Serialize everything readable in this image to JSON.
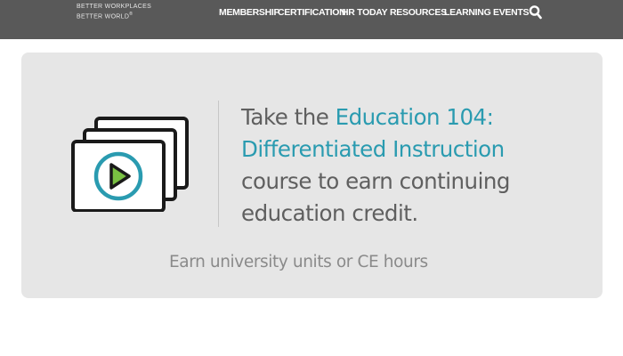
{
  "header": {
    "tagline_line1": "BETTER WORKPLACES",
    "tagline_line2": "BETTER WORLD",
    "trademark": "®",
    "nav": [
      {
        "label": "MEMBERSHIP"
      },
      {
        "label": "CERTIFICATION"
      },
      {
        "label": "HR TODAY"
      },
      {
        "label": "RESOURCES"
      },
      {
        "label": "LEARNING"
      },
      {
        "label": "EVENTS"
      }
    ],
    "search_icon": "search-icon"
  },
  "promo": {
    "icon": "video-course-icon",
    "text_before": "Take the ",
    "course_link": "Education 104: Differentiated Instruction",
    "text_after": " course to earn continuing education credit.",
    "subtext": "Earn university units or CE hours"
  },
  "colors": {
    "header_bg": "#595959",
    "card_bg": "#e6e6e6",
    "link": "#2a9bb0",
    "body_text": "#5f5f5f",
    "sub_text": "#8a8a8a"
  }
}
